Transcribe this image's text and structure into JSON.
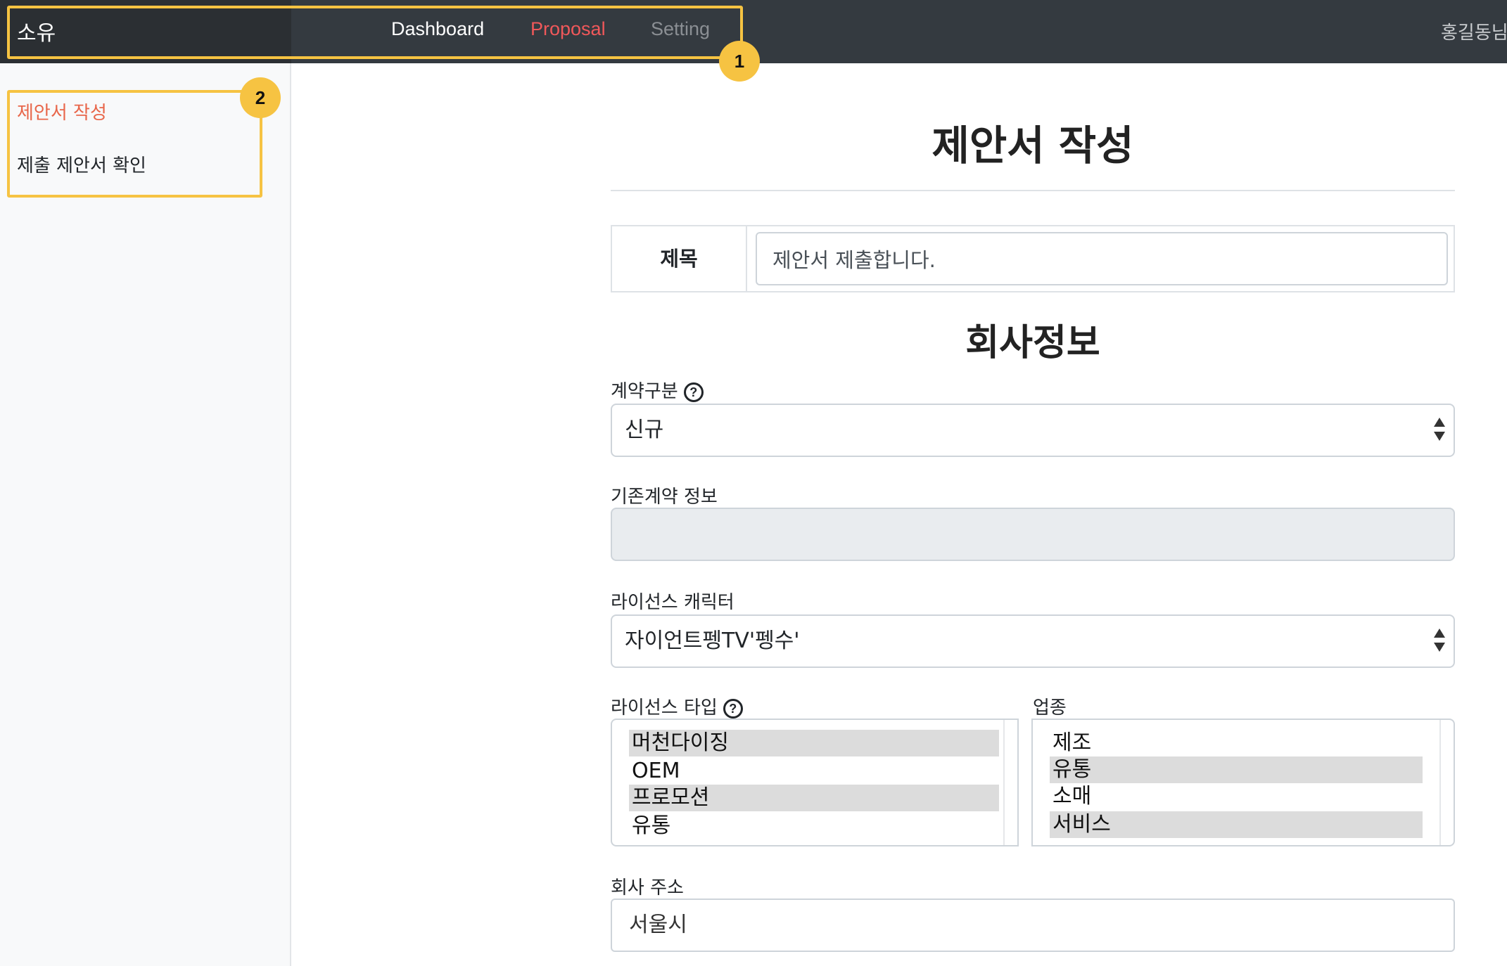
{
  "navbar": {
    "brand": "소유",
    "links": {
      "dashboard": "Dashboard",
      "proposal": "Proposal",
      "setting": "Setting"
    },
    "user": "홍길동님"
  },
  "annotations": {
    "badge1": "1",
    "badge2": "2"
  },
  "sidebar": {
    "items": [
      {
        "label": "제안서 작성"
      },
      {
        "label": "제출 제안서 확인"
      }
    ]
  },
  "main": {
    "page_title": "제안서 작성",
    "title_row": {
      "label": "제목",
      "value": "제안서 제출합니다."
    },
    "section_title": "회사정보",
    "contract_type": {
      "label": "계약구분",
      "value": "신규"
    },
    "existing_contract": {
      "label": "기존계약 정보",
      "value": ""
    },
    "license_character": {
      "label": "라이선스 캐릭터",
      "value": "자이언트펭TV'펭수'"
    },
    "license_type": {
      "label": "라이선스 타입",
      "options": [
        {
          "label": "머천다이징",
          "selected": true
        },
        {
          "label": "OEM",
          "selected": false
        },
        {
          "label": "프로모션",
          "selected": true
        },
        {
          "label": "유통",
          "selected": false
        }
      ]
    },
    "industry": {
      "label": "업종",
      "options": [
        {
          "label": "제조",
          "selected": false
        },
        {
          "label": "유통",
          "selected": true
        },
        {
          "label": "소매",
          "selected": false
        },
        {
          "label": "서비스",
          "selected": true
        }
      ]
    },
    "company_address": {
      "label": "회사 주소",
      "value": "서울시"
    },
    "help_icon_glyph": "?"
  },
  "colors": {
    "navbar_bg": "#343a40",
    "brand_bg": "#2b2f33",
    "active_link": "#f0585a",
    "sidebar_active": "#e8664a",
    "highlight": "#f6c342"
  }
}
